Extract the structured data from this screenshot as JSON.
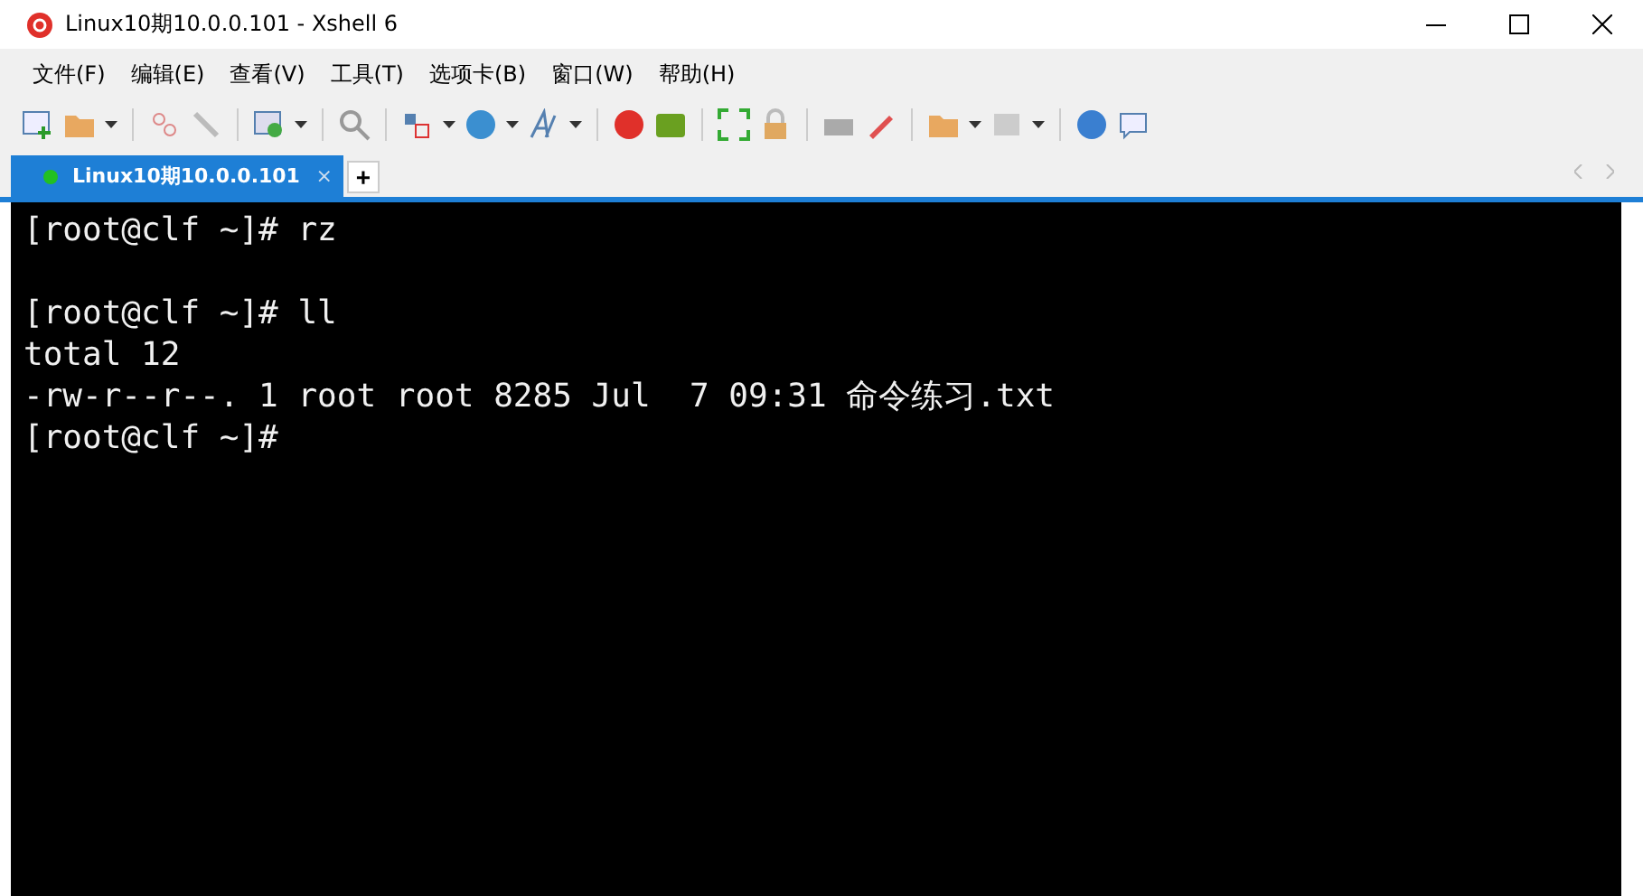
{
  "window": {
    "title": "Linux10期10.0.0.101 - Xshell 6"
  },
  "menu": [
    "文件(F)",
    "编辑(E)",
    "查看(V)",
    "工具(T)",
    "选项卡(B)",
    "窗口(W)",
    "帮助(H)"
  ],
  "tabs": [
    {
      "label": "Linux10期10.0.0.101",
      "selected": true,
      "connected": true,
      "close": "×"
    }
  ],
  "new_tab": "+",
  "terminal": {
    "blocks": [
      [
        "[root@clf ~]# rz"
      ],
      [
        "[root@clf ~]# ll",
        "total 12",
        "-rw-r--r--. 1 root root 8285 Jul  7 09:31 命令练习.txt",
        "[root@clf ~]#"
      ]
    ]
  }
}
